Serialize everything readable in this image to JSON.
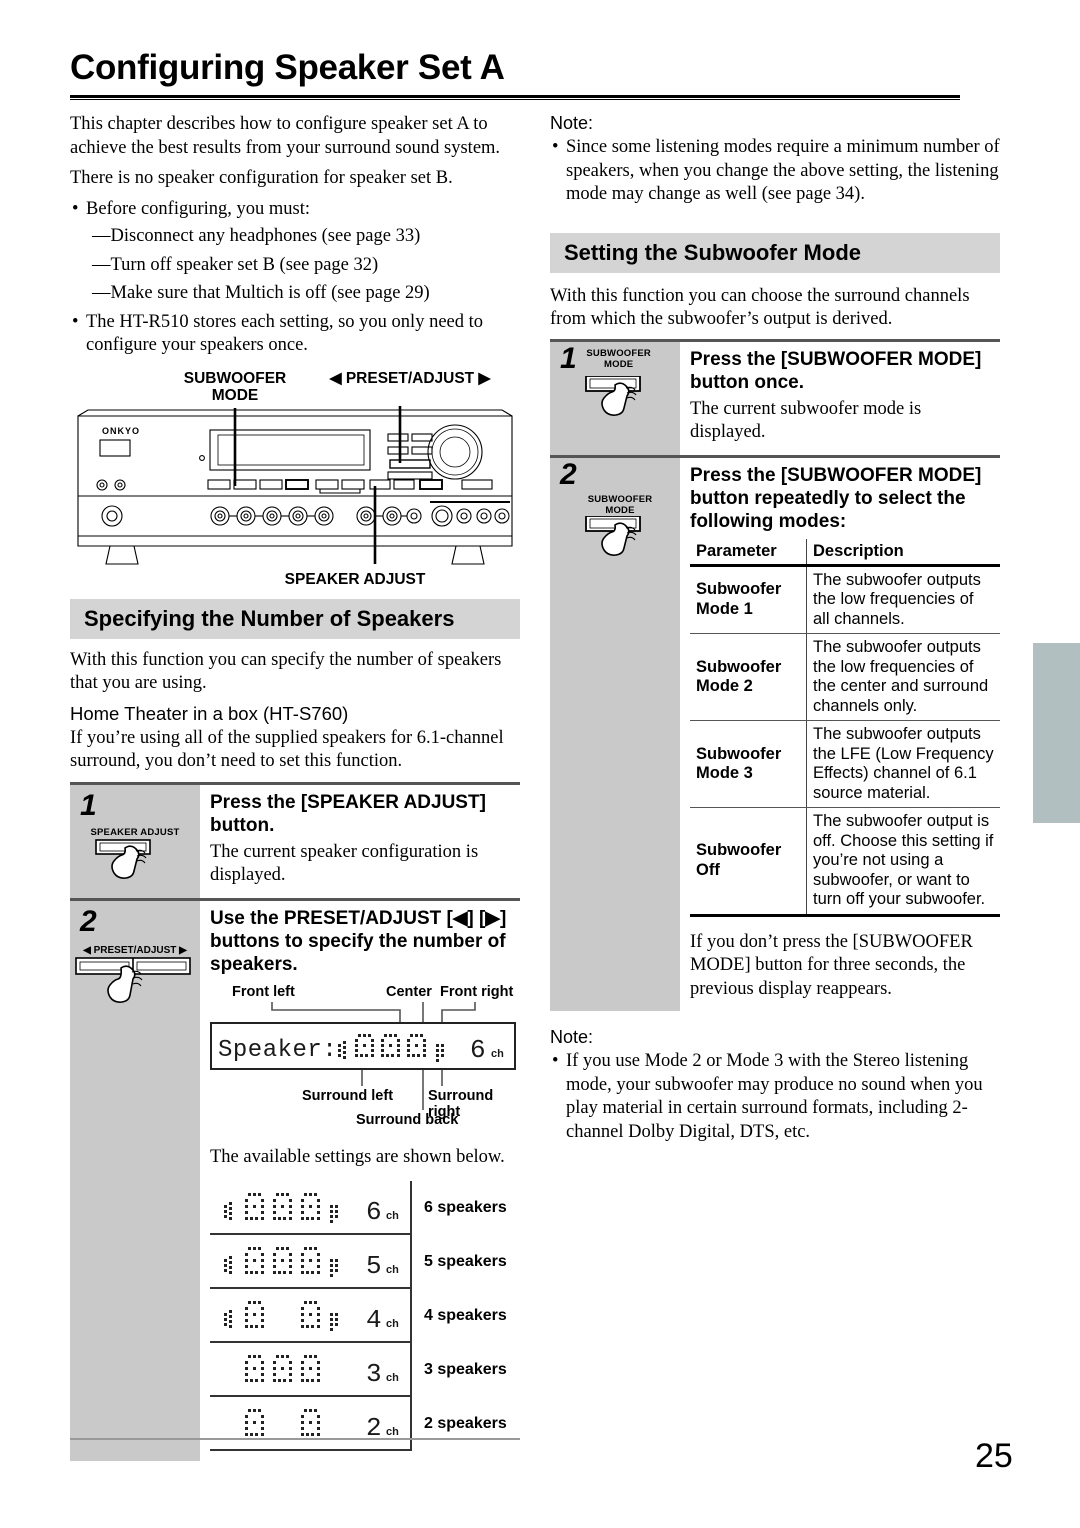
{
  "page": {
    "title": "Configuring Speaker Set A",
    "number": "25"
  },
  "left_column": {
    "intro_p1": "This chapter describes how to configure speaker set A to achieve the best results from your surround sound system.",
    "intro_p2": "There is no speaker configuration for speaker set B.",
    "bullet_1": "Before configuring, you must:",
    "dash_1": "—Disconnect any headphones (see page 33)",
    "dash_2": "—Turn off speaker set B (see page 32)",
    "dash_3": "—Make sure that Multich is off (see page 29)",
    "bullet_2": "The HT-R510 stores each setting, so you only need to configure your speakers once.",
    "diagram": {
      "callout_subwoofer_mode": "SUBWOOFER\nMODE",
      "callout_preset_adjust": "◀ PRESET/ADJUST ▶",
      "callout_speaker_adjust": "SPEAKER ADJUST",
      "brand": "ONKYO"
    },
    "section": {
      "heading": "Specifying the Number of Speakers",
      "para_1": "With this function you can specify the number of speakers that you are using.",
      "subheading": "Home Theater in a box (HT-S760)",
      "para_2": "If you’re using all of the supplied speakers for 6.1-channel surround, you don’t need to set this function.",
      "steps": [
        {
          "number": "1",
          "button_label": "SPEAKER ADJUST",
          "instruction": "Press the [SPEAKER ADJUST] button.",
          "detail": "The current speaker configuration is displayed."
        },
        {
          "number": "2",
          "button_label": "◀  PRESET/ADJUST  ▶",
          "instruction": "Use the PRESET/ADJUST [◀] [▶] buttons to specify the number of speakers.",
          "detail": "The available settings are shown below."
        }
      ],
      "display_labels": {
        "front_left": "Front left",
        "center": "Center",
        "front_right": "Front right",
        "surround_left": "Surround left",
        "surround_right": "Surround right",
        "surround_back": "Surround back"
      },
      "display_text": "Speaker:",
      "display_channels": "6",
      "display_ch_unit": "ch",
      "settings": [
        {
          "channels": "6",
          "ch_unit": "ch",
          "label": "6 speakers",
          "pattern": "sub,fl,c,fr,sb,sl,sr"
        },
        {
          "channels": "5",
          "ch_unit": "ch",
          "label": "5 speakers",
          "pattern": "sub,fl,c,fr,sl,sr"
        },
        {
          "channels": "4",
          "ch_unit": "ch",
          "label": "4 speakers",
          "pattern": "sub,fl,fr,sl,sr"
        },
        {
          "channels": "3",
          "ch_unit": "ch",
          "label": "3 speakers",
          "pattern": "fl,c,fr"
        },
        {
          "channels": "2",
          "ch_unit": "ch",
          "label": "2 speakers",
          "pattern": "fl,fr"
        }
      ]
    }
  },
  "right_column": {
    "note_label_top": "Note:",
    "note_top": "Since some listening modes require a minimum number of speakers, when you change the above setting, the listening mode may change as well (see page 34).",
    "section": {
      "heading": "Setting the Subwoofer Mode",
      "para_1": "With this function you can choose the surround channels from which the subwoofer’s output is derived.",
      "steps": [
        {
          "number": "1",
          "button_label": "SUBWOOFER\nMODE",
          "instruction": "Press the [SUBWOOFER MODE] button once.",
          "detail": "The current subwoofer mode is displayed."
        },
        {
          "number": "2",
          "button_label": "SUBWOOFER\nMODE",
          "instruction": "Press the [SUBWOOFER MODE] button repeatedly to select the following modes:",
          "detail": ""
        }
      ],
      "table": {
        "headers": [
          "Parameter",
          "Description"
        ],
        "rows": [
          {
            "parameter": "Subwoofer Mode 1",
            "description": "The subwoofer outputs the low frequencies of all channels."
          },
          {
            "parameter": "Subwoofer Mode 2",
            "description": "The subwoofer outputs the low frequencies of the center and surround channels only."
          },
          {
            "parameter": "Subwoofer Mode 3",
            "description": "The subwoofer outputs the LFE (Low Frequency Effects) channel of 6.1 source material."
          },
          {
            "parameter": "Subwoofer Off",
            "description": "The subwoofer output is off. Choose this setting if you’re not using a subwoofer, or want to turn off your subwoofer."
          }
        ]
      },
      "after_table": "If you don’t press the [SUBWOOFER MODE] button for three seconds, the previous display reappears."
    },
    "note_label_bottom": "Note:",
    "note_bottom": "If you use Mode 2 or Mode 3 with the Stereo listening mode, your subwoofer may produce no sound when you play material in certain surround formats, including 2-channel Dolby Digital, DTS, etc."
  },
  "colors": {
    "band": "#d4d4d4",
    "step_panel": "#c9c9c9",
    "edge_tab": "#b2bfc0"
  }
}
